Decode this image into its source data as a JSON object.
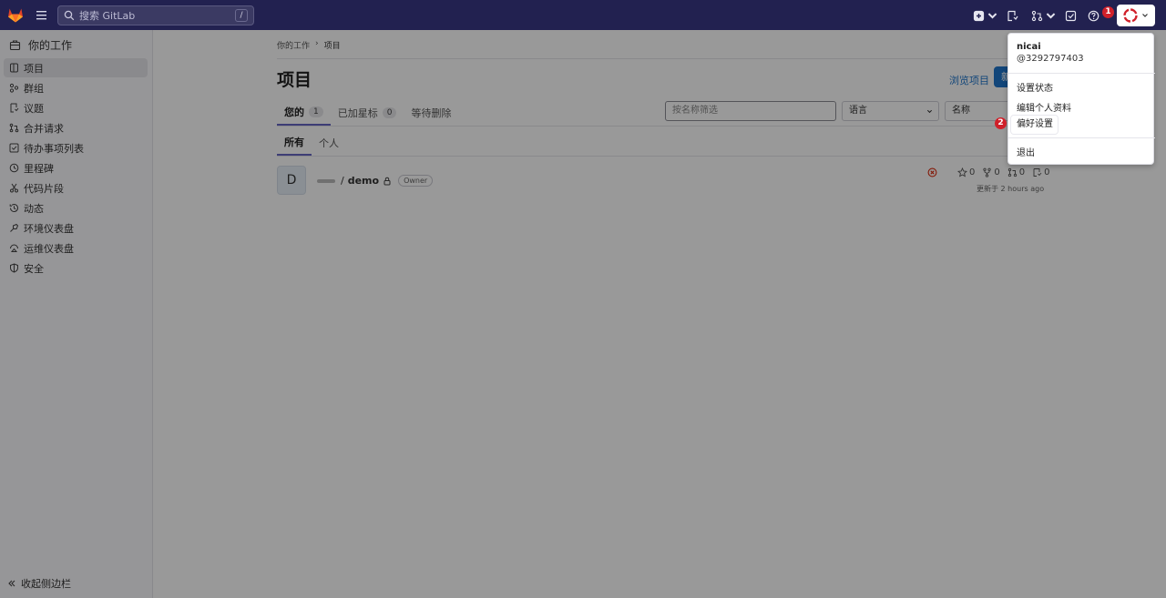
{
  "topbar": {
    "search_placeholder": "搜索 GitLab",
    "search_shortcut": "/",
    "badge1": "1",
    "colors": {
      "bg": "#222150",
      "accent": "#e24329"
    },
    "icons": [
      "gitlab-logo",
      "hamburger-icon",
      "search-icon",
      "plus-square-icon",
      "issues-icon",
      "merge-request-icon",
      "todo-icon",
      "help-icon",
      "avatar-icon"
    ]
  },
  "sidebar": {
    "title": "你的工作",
    "items": [
      {
        "label": "项目",
        "icon": "project-icon",
        "active": true
      },
      {
        "label": "群组",
        "icon": "group-icon"
      },
      {
        "label": "议题",
        "icon": "issues-icon"
      },
      {
        "label": "合并请求",
        "icon": "merge-request-icon"
      },
      {
        "label": "待办事项列表",
        "icon": "todo-icon"
      },
      {
        "label": "里程碑",
        "icon": "milestone-icon"
      },
      {
        "label": "代码片段",
        "icon": "snippet-icon"
      },
      {
        "label": "动态",
        "icon": "activity-icon"
      },
      {
        "label": "环境仪表盘",
        "icon": "environment-icon"
      },
      {
        "label": "运维仪表盘",
        "icon": "operations-icon"
      },
      {
        "label": "安全",
        "icon": "shield-icon"
      }
    ],
    "collapse_label": "收起侧边栏"
  },
  "main": {
    "breadcrumb": {
      "parent": "你的工作",
      "sep": "›",
      "current": "项目"
    },
    "title": "项目",
    "explore_link": "浏览项目",
    "new_button": "新",
    "tabs": [
      {
        "label": "您的",
        "count": "1",
        "active": true
      },
      {
        "label": "已加星标",
        "count": "0"
      },
      {
        "label": "等待删除"
      }
    ],
    "filter_placeholder": "按名称筛选",
    "language_select": "语言",
    "sort_select": "名称",
    "subtabs": [
      {
        "label": "所有",
        "active": true
      },
      {
        "label": "个人"
      }
    ],
    "project": {
      "avatar_letter": "D",
      "separator": "/",
      "name": "demo",
      "role": "Owner",
      "stars": "0",
      "forks": "0",
      "merge_requests": "0",
      "issues": "0",
      "updated": "更新于 2 hours ago"
    }
  },
  "dropdown": {
    "name": "nicai",
    "handle": "@3292797403",
    "items": [
      "设置状态",
      "编辑个人资料",
      "偏好设置",
      "退出"
    ],
    "badge2": "2"
  }
}
